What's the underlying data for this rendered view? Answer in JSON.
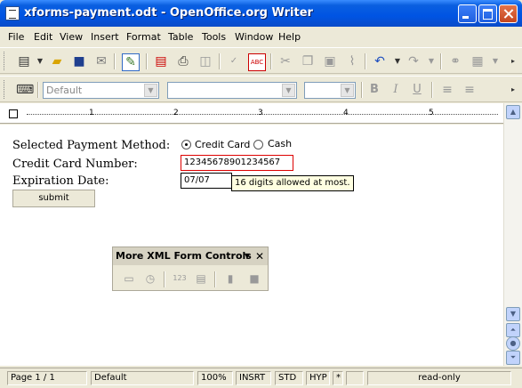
{
  "window": {
    "title": "xforms-payment.odt - OpenOffice.org Writer"
  },
  "menu": {
    "items": [
      "File",
      "Edit",
      "View",
      "Insert",
      "Format",
      "Table",
      "Tools",
      "Window",
      "Help"
    ]
  },
  "format_bar": {
    "style_value": "Default",
    "font_value": "",
    "size_value": "",
    "bold_label": "B",
    "italic_label": "I",
    "underline_label": "U"
  },
  "ruler": {
    "marks": [
      "1",
      "2",
      "3",
      "4",
      "5"
    ]
  },
  "form": {
    "payment_label": "Selected Payment Method:",
    "option_credit": "Credit Card",
    "option_cash": "Cash",
    "selected_option": "Credit Card",
    "card_label": "Credit Card Number:",
    "card_value": "12345678901234567",
    "expiration_label": "Expiration Date:",
    "expiration_value": "07/07",
    "tooltip": "16 digits allowed at most.",
    "submit_label": "submit"
  },
  "floating_toolbar": {
    "title": "More XML Form Controls",
    "numeric_icon_text": "123"
  },
  "status": {
    "page": "Page 1 / 1",
    "style": "Default",
    "zoom": "100%",
    "insert_mode": "INSRT",
    "selection_mode": "STD",
    "hyperlink_mode": "HYP",
    "modified": "*",
    "doc_mode": "read-only"
  },
  "colors": {
    "titlebar": "#0054E3",
    "tooltip_bg": "#FFFFE1",
    "error_border": "#DD0000"
  }
}
